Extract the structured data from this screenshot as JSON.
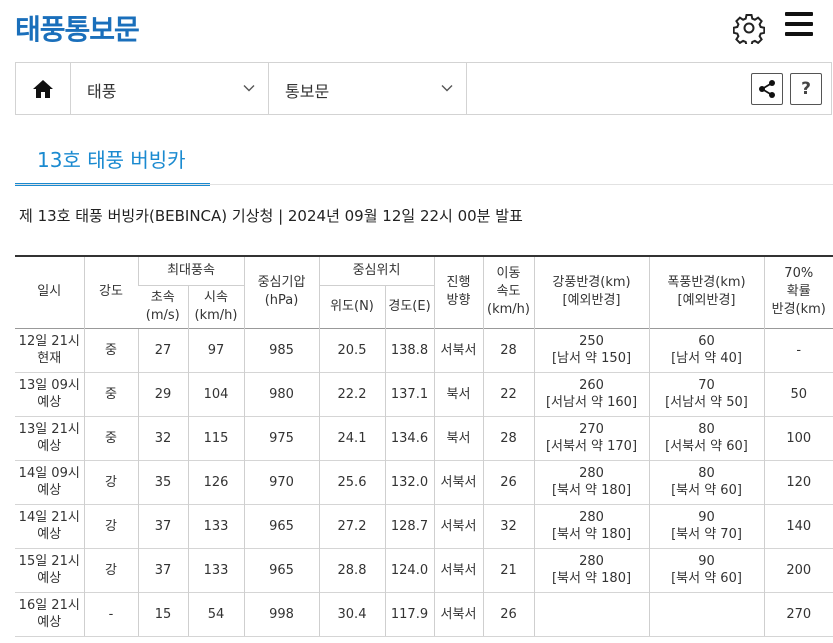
{
  "header": {
    "title": "태풍통보문",
    "settings_icon": "gear-icon",
    "menu_icon": "hamburger-menu-icon"
  },
  "nav": {
    "home_icon": "home-icon",
    "select1": "태풍",
    "select2": "통보문",
    "share_icon": "share-icon",
    "help_label": "?"
  },
  "tab": {
    "label": "13호 태풍 버빙카"
  },
  "subtitle": "제 13호 태풍 버빙카(BEBINCA) 기상청 | 2024년 09월 12일 22시 00분 발표",
  "table": {
    "headers": {
      "datetime": "일시",
      "intensity": "강도",
      "max_wind": "최대풍속",
      "wind_ms": "초속\n(m/s)",
      "wind_kmh": "시속\n(km/h)",
      "pressure": "중심기압\n(hPa)",
      "center_pos": "중심위치",
      "lat": "위도(N)",
      "lon": "경도(E)",
      "direction": "진행\n방향",
      "speed": "이동\n속도\n(km/h)",
      "strong_radius": "강풍반경(km)\n[예외반경]",
      "storm_radius": "폭풍반경(km)\n[예외반경]",
      "prob_radius": "70%\n확률\n반경(km)"
    },
    "rows": [
      {
        "datetime": "12일 21시\n현재",
        "intensity": "중",
        "wind_ms": "27",
        "wind_kmh": "97",
        "pressure": "985",
        "lat": "20.5",
        "lon": "138.8",
        "direction": "서북서",
        "speed": "28",
        "strong": "250\n[남서 약 150]",
        "storm": "60\n[남서 약 40]",
        "prob": "-"
      },
      {
        "datetime": "13일 09시\n예상",
        "intensity": "중",
        "wind_ms": "29",
        "wind_kmh": "104",
        "pressure": "980",
        "lat": "22.2",
        "lon": "137.1",
        "direction": "북서",
        "speed": "22",
        "strong": "260\n[서남서 약 160]",
        "storm": "70\n[서남서 약 50]",
        "prob": "50"
      },
      {
        "datetime": "13일 21시\n예상",
        "intensity": "중",
        "wind_ms": "32",
        "wind_kmh": "115",
        "pressure": "975",
        "lat": "24.1",
        "lon": "134.6",
        "direction": "북서",
        "speed": "28",
        "strong": "270\n[서북서 약 170]",
        "storm": "80\n[서북서 약 60]",
        "prob": "100"
      },
      {
        "datetime": "14일 09시\n예상",
        "intensity": "강",
        "wind_ms": "35",
        "wind_kmh": "126",
        "pressure": "970",
        "lat": "25.6",
        "lon": "132.0",
        "direction": "서북서",
        "speed": "26",
        "strong": "280\n[북서 약 180]",
        "storm": "80\n[북서 약 60]",
        "prob": "120"
      },
      {
        "datetime": "14일 21시\n예상",
        "intensity": "강",
        "wind_ms": "37",
        "wind_kmh": "133",
        "pressure": "965",
        "lat": "27.2",
        "lon": "128.7",
        "direction": "서북서",
        "speed": "32",
        "strong": "280\n[북서 약 180]",
        "storm": "90\n[북서 약 70]",
        "prob": "140"
      },
      {
        "datetime": "15일 21시\n예상",
        "intensity": "강",
        "wind_ms": "37",
        "wind_kmh": "133",
        "pressure": "965",
        "lat": "28.8",
        "lon": "124.0",
        "direction": "서북서",
        "speed": "21",
        "strong": "280\n[북서 약 180]",
        "storm": "90\n[북서 약 60]",
        "prob": "200"
      },
      {
        "datetime": "16일 21시\n예상",
        "intensity": "-",
        "wind_ms": "15",
        "wind_kmh": "54",
        "pressure": "998",
        "lat": "30.4",
        "lon": "117.9",
        "direction": "서북서",
        "speed": "26",
        "strong": "",
        "storm": "",
        "prob": "270"
      }
    ]
  }
}
